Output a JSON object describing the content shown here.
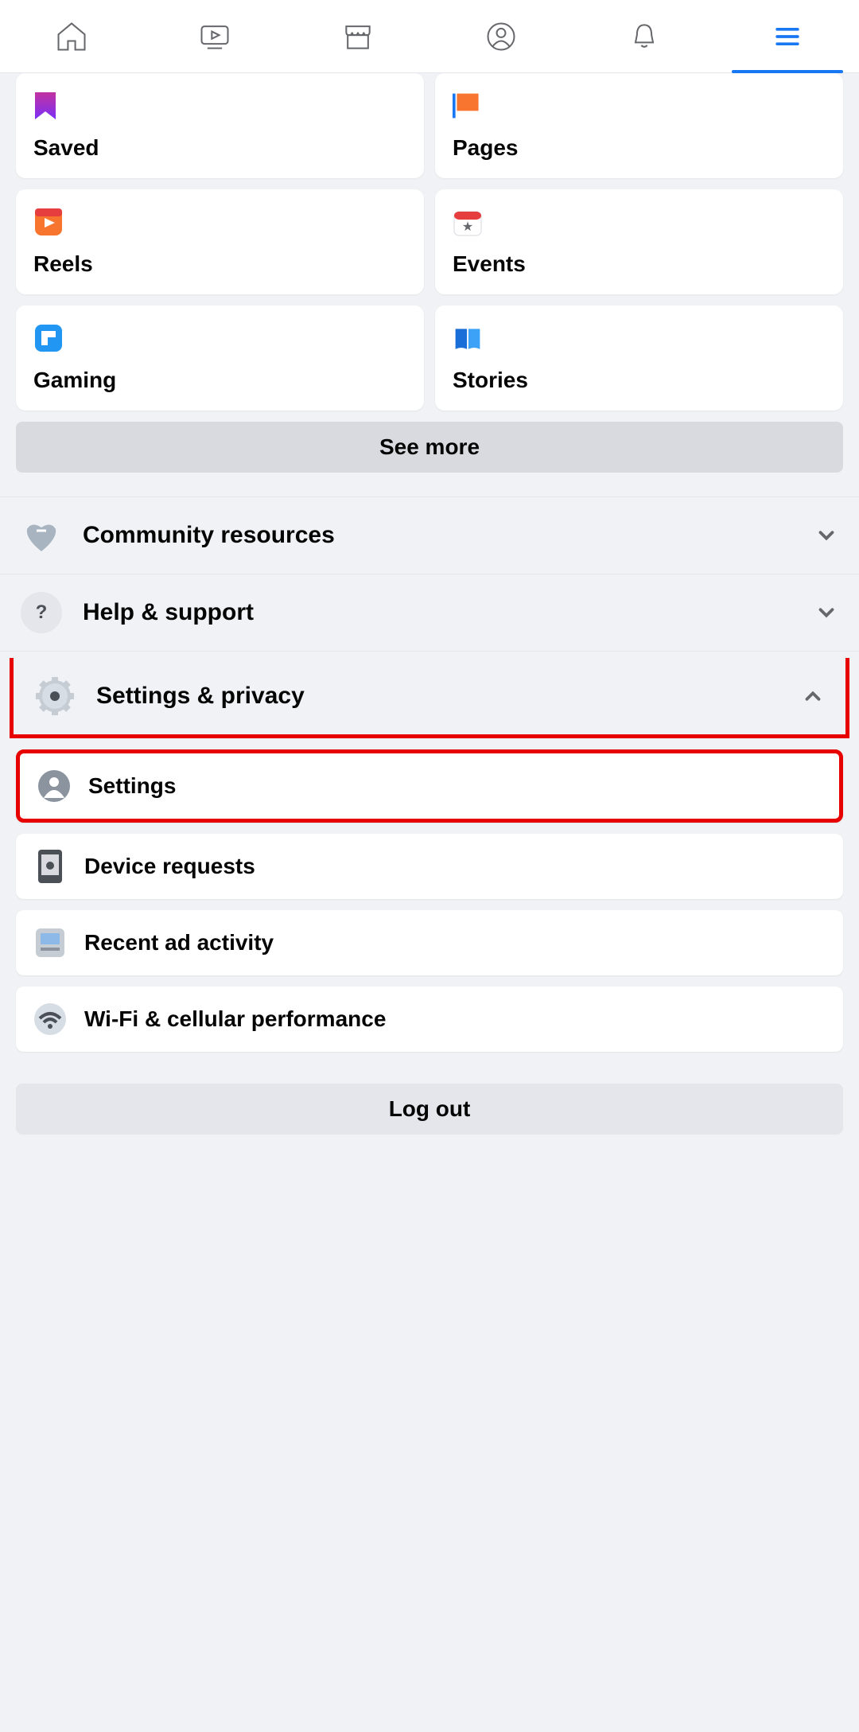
{
  "nav": {
    "tabs": [
      "home",
      "video",
      "marketplace",
      "profile",
      "notifications",
      "menu"
    ],
    "active": "menu"
  },
  "shortcuts": [
    {
      "id": "saved",
      "label": "Saved"
    },
    {
      "id": "pages",
      "label": "Pages"
    },
    {
      "id": "reels",
      "label": "Reels"
    },
    {
      "id": "events",
      "label": "Events"
    },
    {
      "id": "gaming",
      "label": "Gaming"
    },
    {
      "id": "stories",
      "label": "Stories"
    }
  ],
  "see_more_label": "See more",
  "sections": {
    "community": {
      "label": "Community resources",
      "expanded": false
    },
    "help": {
      "label": "Help & support",
      "expanded": false
    },
    "settings_privacy": {
      "label": "Settings & privacy",
      "expanded": true,
      "highlighted": true
    }
  },
  "settings_privacy_items": [
    {
      "id": "settings",
      "label": "Settings",
      "highlighted": true
    },
    {
      "id": "device_requests",
      "label": "Device requests",
      "highlighted": false
    },
    {
      "id": "recent_ad_activity",
      "label": "Recent ad activity",
      "highlighted": false
    },
    {
      "id": "wifi_cellular",
      "label": "Wi-Fi & cellular performance",
      "highlighted": false
    }
  ],
  "logout_label": "Log out"
}
